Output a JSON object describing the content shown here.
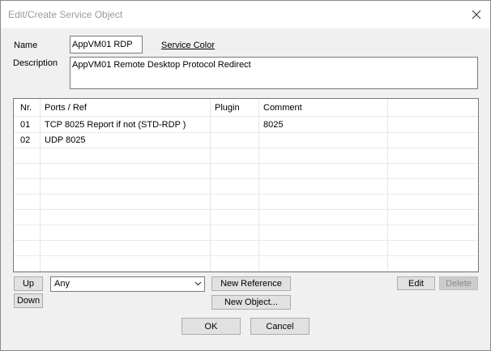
{
  "window": {
    "title": "Edit/Create Service Object"
  },
  "form": {
    "name_label": "Name",
    "name_value": "AppVM01 RDP",
    "service_color_link": "Service Color",
    "description_label": "Description",
    "description_value": "AppVM01 Remote Desktop Protocol Redirect"
  },
  "table": {
    "columns": [
      "Nr.",
      "Ports / Ref",
      "Plugin",
      "Comment"
    ],
    "rows": [
      {
        "nr": "01",
        "ports": "TCP  8025  Report if not (STD-RDP )",
        "plugin": "",
        "comment": "8025"
      },
      {
        "nr": "02",
        "ports": "UDP  8025",
        "plugin": "",
        "comment": ""
      }
    ]
  },
  "controls": {
    "up_label": "Up",
    "down_label": "Down",
    "select_value": "Any",
    "new_reference_label": "New Reference",
    "new_object_label": "New Object...",
    "edit_label": "Edit",
    "delete_label": "Delete",
    "ok_label": "OK",
    "cancel_label": "Cancel"
  }
}
